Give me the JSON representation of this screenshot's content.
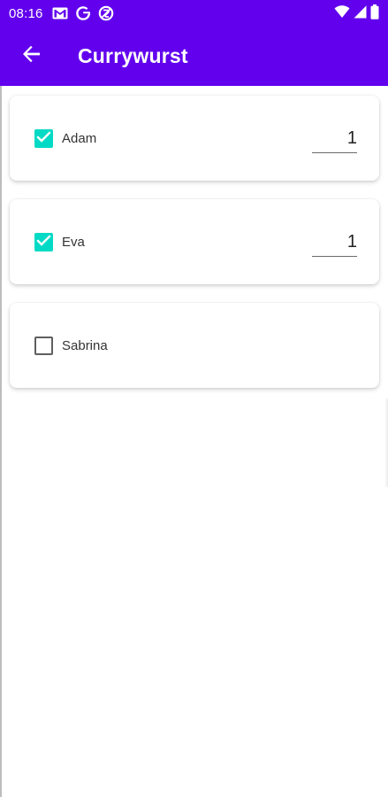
{
  "status_bar": {
    "time": "08:16",
    "icons": [
      "gmail-icon",
      "google-icon",
      "sync-icon",
      "wifi-icon",
      "signal-icon",
      "battery-icon"
    ]
  },
  "app_bar": {
    "title": "Currywurst",
    "back_icon": "arrow-left-icon"
  },
  "colors": {
    "primary": "#6200ee",
    "checkbox_accent": "#03dac5"
  },
  "people": [
    {
      "name": "Adam",
      "checked": true,
      "quantity": "1"
    },
    {
      "name": "Eva",
      "checked": true,
      "quantity": "1"
    },
    {
      "name": "Sabrina",
      "checked": false,
      "quantity": ""
    }
  ]
}
